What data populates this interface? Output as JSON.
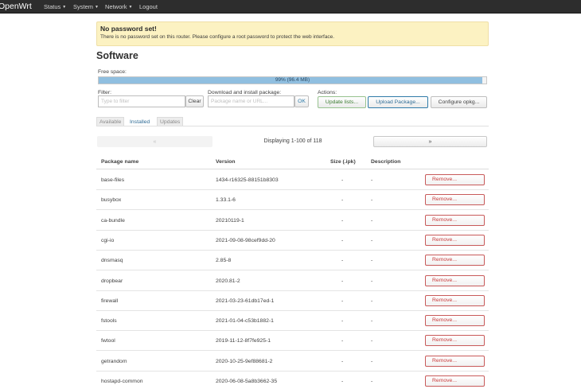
{
  "nav": {
    "brand": "OpenWrt",
    "items": [
      {
        "label": "Status",
        "dropdown": true
      },
      {
        "label": "System",
        "dropdown": true
      },
      {
        "label": "Network",
        "dropdown": true
      },
      {
        "label": "Logout",
        "dropdown": false
      }
    ]
  },
  "alert": {
    "title": "No password set!",
    "text": "There is no password set on this router. Please configure a root password to protect the web interface."
  },
  "page": {
    "title": "Software"
  },
  "free_space": {
    "label": "Free space:",
    "percent": 99,
    "text": "99% (96.4 MB)"
  },
  "filter": {
    "label": "Filter:",
    "placeholder": "Type to filter",
    "value": "",
    "clear_label": "Clear"
  },
  "download": {
    "label": "Download and install package:",
    "placeholder": "Package name or URL...",
    "value": "",
    "ok_label": "OK"
  },
  "actions": {
    "label": "Actions:",
    "update_lists": "Update lists...",
    "upload_package": "Upload Package...",
    "configure_opkg": "Configure opkg..."
  },
  "tabs": [
    {
      "label": "Available",
      "active": false
    },
    {
      "label": "Installed",
      "active": true
    },
    {
      "label": "Updates",
      "active": false
    }
  ],
  "pager": {
    "prev": "«",
    "next": "»",
    "text": "Displaying 1-100 of 118"
  },
  "table": {
    "headers": {
      "name": "Package name",
      "version": "Version",
      "size": "Size (.ipk)",
      "description": "Description"
    },
    "remove_label": "Remove...",
    "rows": [
      {
        "name": "base-files",
        "version": "1434-r16325-88151b8303",
        "size": "-",
        "description": "-"
      },
      {
        "name": "busybox",
        "version": "1.33.1-6",
        "size": "-",
        "description": "-"
      },
      {
        "name": "ca-bundle",
        "version": "20210119-1",
        "size": "-",
        "description": "-"
      },
      {
        "name": "cgi-io",
        "version": "2021-09-08-98cef9dd-20",
        "size": "-",
        "description": "-"
      },
      {
        "name": "dnsmasq",
        "version": "2.85-8",
        "size": "-",
        "description": "-"
      },
      {
        "name": "dropbear",
        "version": "2020.81-2",
        "size": "-",
        "description": "-"
      },
      {
        "name": "firewall",
        "version": "2021-03-23-61db17ed-1",
        "size": "-",
        "description": "-"
      },
      {
        "name": "fstools",
        "version": "2021-01-04-c53b1882-1",
        "size": "-",
        "description": "-"
      },
      {
        "name": "fwtool",
        "version": "2019-11-12-8f7fe925-1",
        "size": "-",
        "description": "-"
      },
      {
        "name": "getrandom",
        "version": "2020-10-25-9ef88681-2",
        "size": "-",
        "description": "-"
      },
      {
        "name": "hostapd-common",
        "version": "2020-06-08-5a8b3662-35",
        "size": "-",
        "description": "-"
      }
    ]
  },
  "colors": {
    "topbar": "#2d2d2d",
    "alert_bg": "#fcf2c2",
    "progress_fill": "#90bfe0",
    "remove_border": "#c85a5a",
    "link_blue": "#2f6c95"
  }
}
